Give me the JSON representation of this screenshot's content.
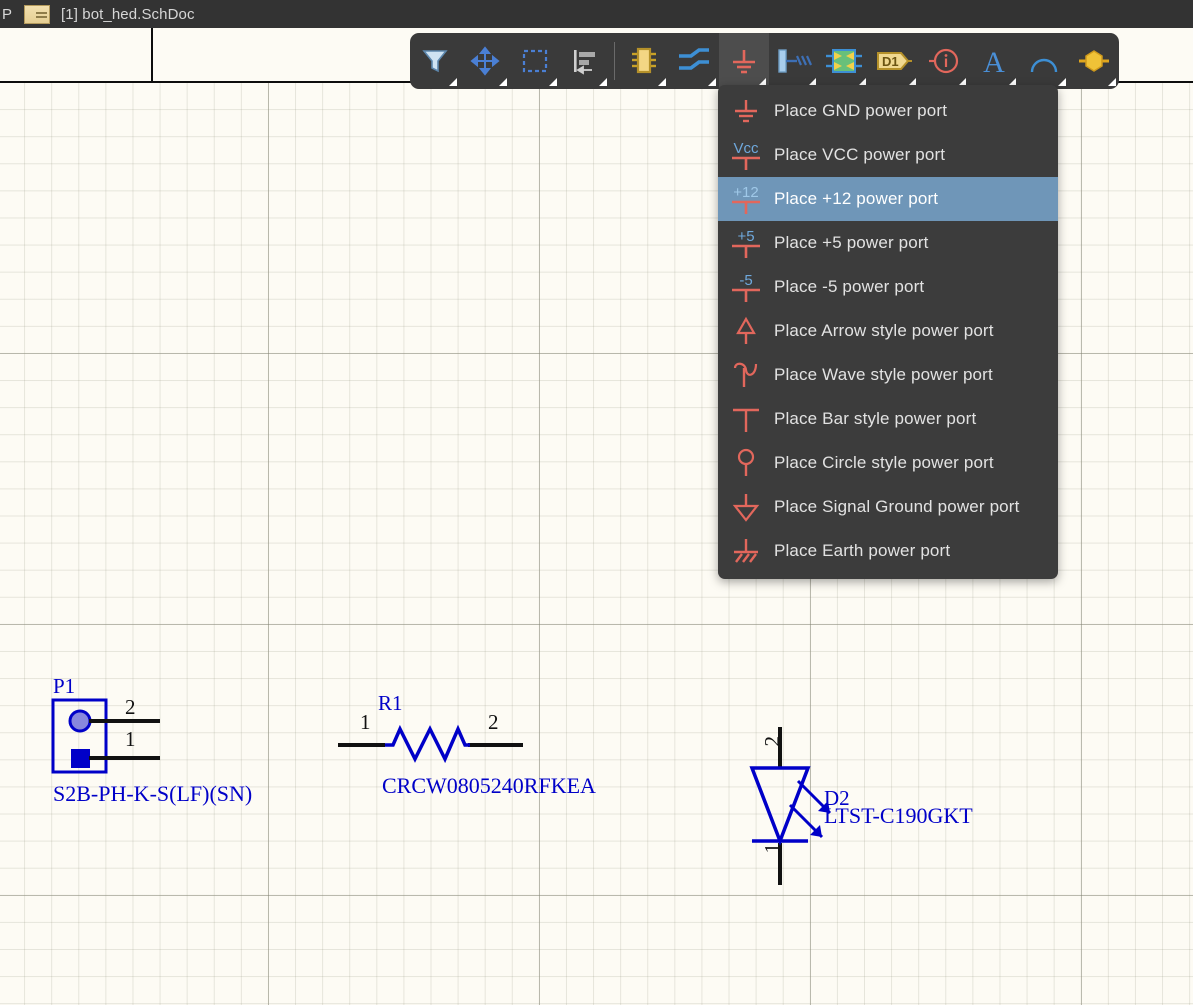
{
  "titlebar": {
    "left_char": "P",
    "doc_icon": "schematic-document-icon",
    "document": "[1] bot_hed.SchDoc"
  },
  "toolbar": {
    "buttons": [
      {
        "name": "filter-tool",
        "icon": "funnel-icon",
        "active": false
      },
      {
        "name": "move-tool",
        "icon": "move-cross-arrows-icon",
        "active": false
      },
      {
        "name": "selection-tool",
        "icon": "dashed-rectangle-icon",
        "active": false
      },
      {
        "name": "align-tool",
        "icon": "align-left-icon",
        "active": false
      },
      {
        "name": "place-part-tool",
        "icon": "ic-chip-icon",
        "active": false
      },
      {
        "name": "place-wire-tool",
        "icon": "wire-icon",
        "active": false
      },
      {
        "name": "place-power-port-tool",
        "icon": "gnd-power-port-icon",
        "active": true
      },
      {
        "name": "place-bus-entry-tool",
        "icon": "bus-entry-icon",
        "active": false
      },
      {
        "name": "place-port-tool",
        "icon": "sheet-port-icon",
        "active": false
      },
      {
        "name": "place-net-label-tool",
        "icon": "net-label-d1-icon",
        "active": false
      },
      {
        "name": "place-no-erc-tool",
        "icon": "no-erc-info-icon",
        "active": false
      },
      {
        "name": "place-text-tool",
        "icon": "text-a-icon",
        "active": false
      },
      {
        "name": "place-arc-tool",
        "icon": "arc-icon",
        "active": false
      },
      {
        "name": "place-junction-tool",
        "icon": "junction-hexagon-icon",
        "active": false
      }
    ]
  },
  "menu": {
    "selected_index": 2,
    "items": [
      {
        "icon": "gnd-power-port-icon",
        "label": "Place GND power port"
      },
      {
        "icon": "vcc-power-port-icon",
        "label": "Place VCC power port"
      },
      {
        "icon": "plus12-power-port-icon",
        "label": "Place +12 power port"
      },
      {
        "icon": "plus5-power-port-icon",
        "label": "Place +5 power port"
      },
      {
        "icon": "minus5-power-port-icon",
        "label": "Place -5 power port"
      },
      {
        "icon": "arrow-power-port-icon",
        "label": "Place Arrow style power port"
      },
      {
        "icon": "wave-power-port-icon",
        "label": "Place Wave style power port"
      },
      {
        "icon": "bar-power-port-icon",
        "label": "Place Bar style power port"
      },
      {
        "icon": "circle-power-port-icon",
        "label": "Place Circle style power port"
      },
      {
        "icon": "signal-ground-power-port-icon",
        "label": "Place Signal Ground power port"
      },
      {
        "icon": "earth-power-port-icon",
        "label": "Place Earth power port"
      }
    ],
    "icon_labels": {
      "vcc": "Vcc",
      "plus12": "+12",
      "plus5": "+5",
      "minus5": "-5"
    }
  },
  "schematic": {
    "components": [
      {
        "name": "connector-p1",
        "designator": "P1",
        "comment": "S2B-PH-K-S(LF)(SN)",
        "pins": [
          "2",
          "1"
        ]
      },
      {
        "name": "resistor-r1",
        "designator": "R1",
        "comment": "CRCW0805240RFKEA",
        "pins": [
          "1",
          "2"
        ]
      },
      {
        "name": "led-d2",
        "designator": "D2",
        "comment": "LTST-C190GKT",
        "pins": [
          "2",
          "1"
        ]
      }
    ]
  },
  "colors": {
    "canvas": "#fdfbf4",
    "chrome": "#333333",
    "toolbar": "#3a3a3a",
    "menu": "#3c3c3c",
    "menu_selected": "#6f96b8",
    "power_port_red": "#e2675c",
    "power_port_blue": "#6fa8dc",
    "schematic_blue": "#0000c8",
    "pin_black": "#111111"
  }
}
